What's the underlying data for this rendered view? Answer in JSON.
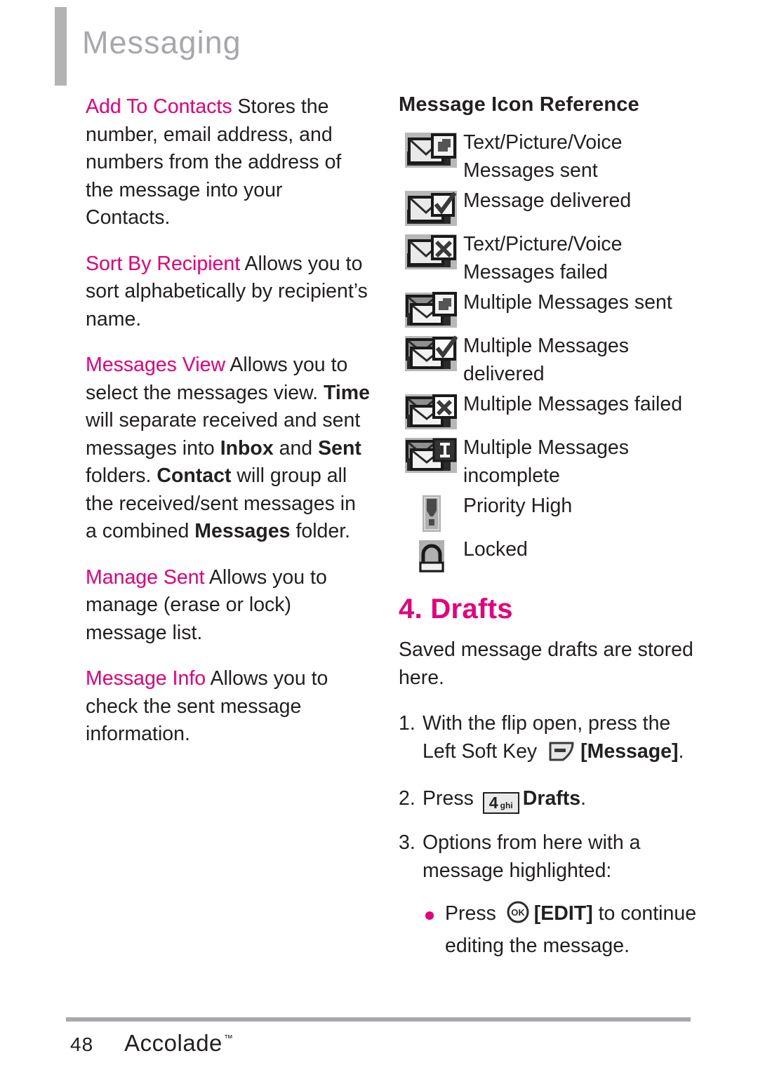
{
  "header": {
    "title": "Messaging"
  },
  "left_column": {
    "paragraphs": [
      {
        "term": "Add To Contacts",
        "text": " Stores the number, email address, and numbers from the address of the message into your Contacts."
      },
      {
        "term": "Sort By Recipient",
        "text": " Allows you to sort alphabetically by recipient’s name."
      },
      {
        "term": "Messages View",
        "text": " Allows you to select the messages view. Time will separate received and sent messages into Inbox and Sent folders. Contact will group all the received/sent messages in a combined Messages folder.",
        "bold_words": [
          "Time",
          "Inbox",
          "Sent",
          "Contact",
          "Messages"
        ]
      },
      {
        "term": "Manage Sent",
        "text": " Allows you to manage (erase or lock) message list."
      },
      {
        "term": "Message Info",
        "text": " Allows you to check the sent message information."
      }
    ]
  },
  "right_column": {
    "icon_reference": {
      "title": "Message Icon Reference",
      "items": [
        {
          "icon": "envelope-arrow-icon",
          "label": "Text/Picture/Voice Messages sent"
        },
        {
          "icon": "envelope-check-icon",
          "label": "Message delivered"
        },
        {
          "icon": "envelope-x-icon",
          "label": "Text/Picture/Voice Messages failed"
        },
        {
          "icon": "multi-envelope-arrow-icon",
          "label": "Multiple Messages sent"
        },
        {
          "icon": "multi-envelope-check-icon",
          "label": "Multiple Messages delivered"
        },
        {
          "icon": "multi-envelope-x-icon",
          "label": "Multiple Messages failed"
        },
        {
          "icon": "multi-envelope-incomplete-icon",
          "label": "Multiple Messages incomplete"
        },
        {
          "icon": "priority-high-icon",
          "label": "Priority High"
        },
        {
          "icon": "locked-padlock-icon",
          "label": "Locked"
        }
      ]
    },
    "drafts": {
      "title": "4. Drafts",
      "intro": "Saved message drafts are stored here.",
      "steps": [
        {
          "num": "1.",
          "text_before": "With the flip open, press the Left Soft Key ",
          "icon": "left-soft-key-icon",
          "text_bold": "[Message]",
          "text_after": "."
        },
        {
          "num": "2.",
          "text_before": "Press ",
          "key_digit": "4",
          "key_letters": "ghi",
          "text_bold": "Drafts",
          "text_after": "."
        },
        {
          "num": "3.",
          "text_before": "Options from here with a message highlighted:"
        }
      ],
      "bullets": [
        {
          "text_before": "Press ",
          "icon": "ok-key-icon",
          "text_bold": "[EDIT]",
          "text_after": " to continue editing the message."
        }
      ]
    }
  },
  "footer": {
    "page_number": "48",
    "brand": "Accolade",
    "trademark": "™"
  },
  "colors": {
    "accent_magenta": "#e5007e",
    "header_gray": "#a6a8ab",
    "body_text": "#231f20"
  }
}
